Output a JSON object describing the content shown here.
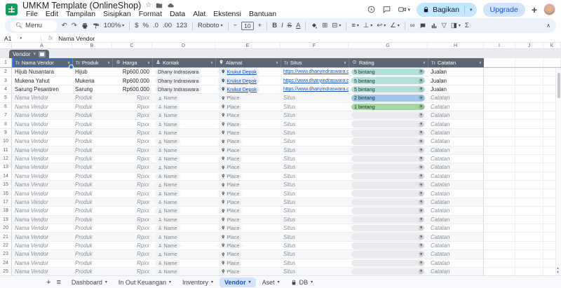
{
  "app": {
    "title": "UMKM Template (OnlineShop)",
    "title_icons": [
      "star-icon",
      "move-folder-icon",
      "cloud-saved-icon"
    ],
    "menu_items": [
      "File",
      "Edit",
      "Tampilan",
      "Sisipkan",
      "Format",
      "Data",
      "Alat",
      "Ekstensi",
      "Bantuan"
    ],
    "share_button": "Bagikan",
    "upgrade_button": "Upgrade"
  },
  "toolbar": {
    "search_label": "Menu",
    "zoom_value": "100%",
    "currency": "$",
    "percent": "%",
    "decimal_decrease": ".0",
    "decimal_increase": ".00",
    "number_format": "123",
    "font_name": "Roboto",
    "font_size": "10"
  },
  "formula_bar": {
    "cell_ref": "A1",
    "value": "Nama Vendor"
  },
  "grid": {
    "column_letters": [
      "A",
      "B",
      "C",
      "D",
      "E",
      "F",
      "G",
      "H",
      "I",
      "J",
      "K"
    ],
    "first_row": 1,
    "last_row": 25
  },
  "table": {
    "name": "Vendor",
    "header_color": "#5a6672",
    "columns": [
      {
        "label": "Nama Vendor",
        "type_icon": "text-type-icon"
      },
      {
        "label": "Produk",
        "type_icon": "text-type-icon"
      },
      {
        "label": "Harga",
        "type_icon": "currency-type-icon"
      },
      {
        "label": "Kontak",
        "type_icon": "person-type-icon"
      },
      {
        "label": "Alamat",
        "type_icon": "location-type-icon"
      },
      {
        "label": "Situs",
        "type_icon": "text-type-icon"
      },
      {
        "label": "Rating",
        "type_icon": "dropdown-type-icon"
      },
      {
        "label": "Catatan",
        "type_icon": "text-type-icon"
      }
    ],
    "rows": [
      {
        "nama_vendor": "Hijub Nusantara",
        "produk": "Hijub",
        "harga": "Rp600.000",
        "kontak": "Dhany Indraswara",
        "alamat": "Krukut Depok",
        "situs": "https://www.dhanyindraswara.com/",
        "rating": "5 bintang",
        "rating_color": "#b3dfdb",
        "catatan": "Jualan"
      },
      {
        "nama_vendor": "Mukena Yahut",
        "produk": "Mukena",
        "harga": "Rp600.000",
        "kontak": "Dhany Indraswara",
        "alamat": "Krukut Depok",
        "situs": "https://www.dhanyindraswara.com/",
        "rating": "5 bintang",
        "rating_color": "#b3dfdb",
        "catatan": "Jualan"
      },
      {
        "nama_vendor": "Sarung Pesantren",
        "produk": "Sarung",
        "harga": "Rp600.000",
        "kontak": "Dhany Indraswara",
        "alamat": "Krukut Depok",
        "situs": "https://www.dhanyindraswara.com/",
        "rating": "5 bintang",
        "rating_color": "#b3dfdb",
        "catatan": "Jualan"
      }
    ],
    "placeholder_row": {
      "nama_vendor": "Nama Vendor",
      "produk": "Produk",
      "harga": "Rpxx",
      "kontak": "Name",
      "alamat": "Place",
      "situs": "Situs",
      "catatan": "Catatan"
    },
    "placeholder_rows_from": 5,
    "placeholder_rows_to": 25,
    "placeholder_ratings": [
      {
        "row": 5,
        "label": "2 bintang",
        "color": "#9fc5e8"
      },
      {
        "row": 6,
        "label": "1 bintang",
        "color": "#a5d7a5"
      }
    ],
    "empty_rating_color": "#e8eaed"
  },
  "sheet_tabs": {
    "items": [
      {
        "label": "Dashboard",
        "active": false,
        "locked": false
      },
      {
        "label": "In Out Keuangan",
        "active": false,
        "locked": false
      },
      {
        "label": "Inventory",
        "active": false,
        "locked": false
      },
      {
        "label": "Vendor",
        "active": true,
        "locked": false
      },
      {
        "label": "Aset",
        "active": false,
        "locked": false
      },
      {
        "label": "DB",
        "active": false,
        "locked": true
      }
    ]
  }
}
